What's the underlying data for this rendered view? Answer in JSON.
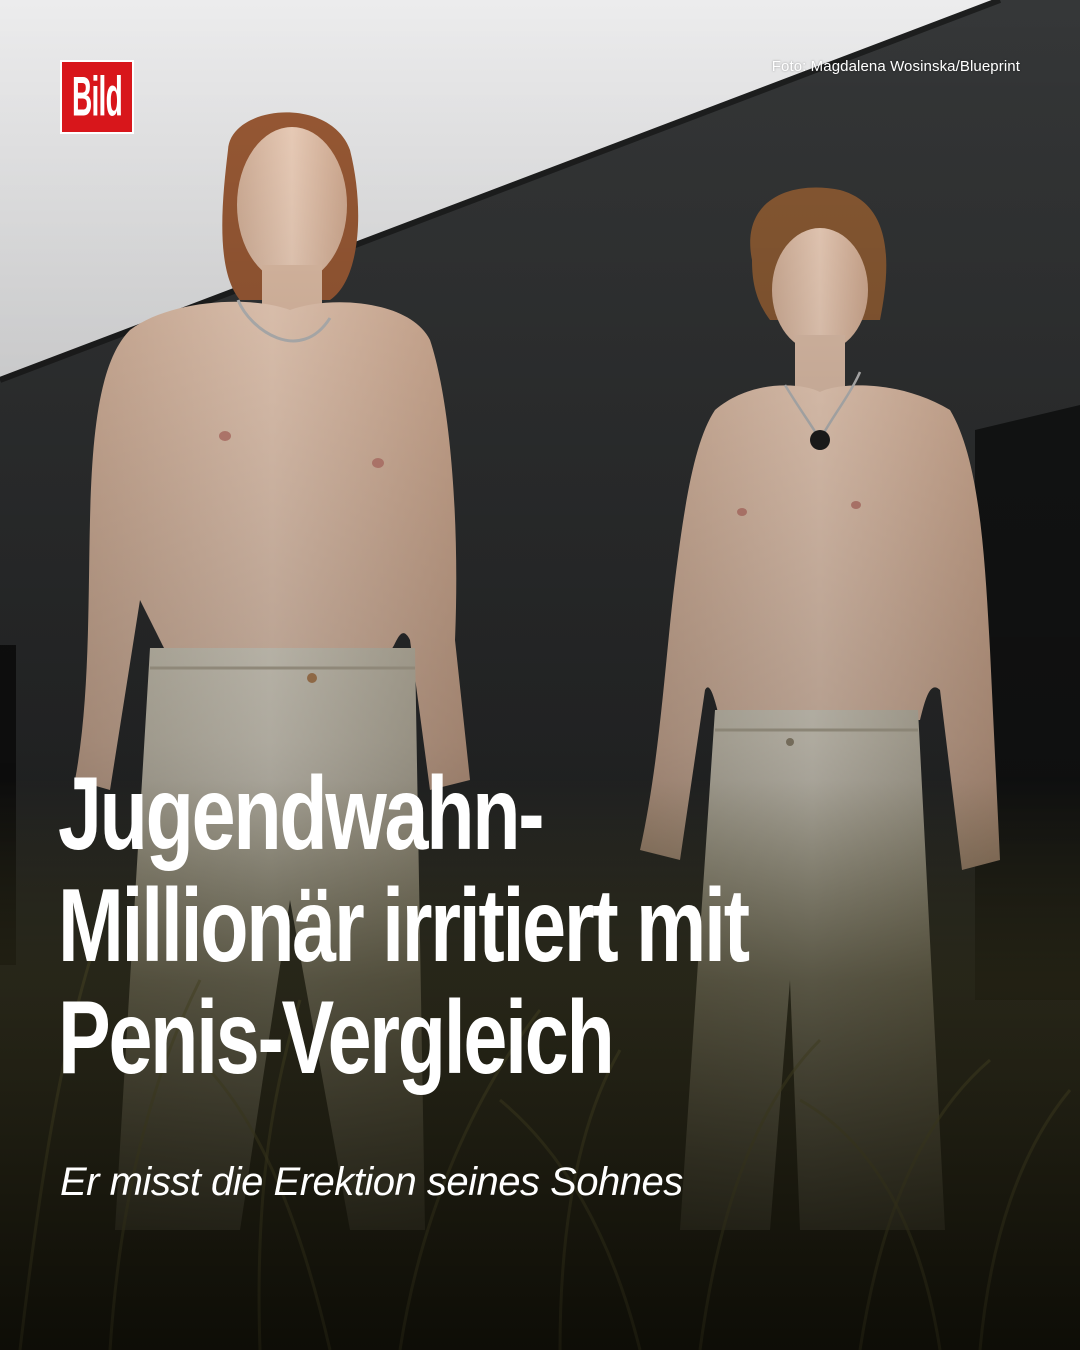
{
  "brand": {
    "logo_text": "Bild",
    "color": "#d8161b"
  },
  "photo_credit": "Foto: Magdalena Wosinska/Blueprint",
  "headline": {
    "lines": [
      "Jugendwahn-",
      "Millionär irritiert mit",
      "Penis-Vergleich"
    ]
  },
  "subline": "Er misst die Erektion seines Sohnes",
  "colors": {
    "sky": "#e3e5e6",
    "wall": "#2b2d2e",
    "grass": "#59552a",
    "text": "#ffffff"
  }
}
